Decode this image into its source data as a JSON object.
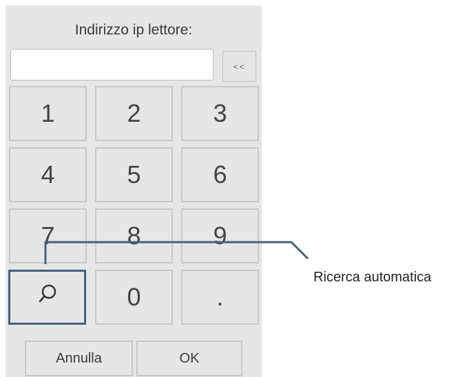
{
  "dialog": {
    "title": "Indirizzo ip lettore:",
    "ip_input": {
      "value": "",
      "placeholder": ""
    },
    "backspace_label": "<<",
    "keys": [
      "1",
      "2",
      "3",
      "4",
      "5",
      "6",
      "7",
      "8",
      "9",
      "",
      "0",
      "."
    ],
    "search_key_icon": "search-icon",
    "cancel_label": "Annulla",
    "ok_label": "OK"
  },
  "callout": {
    "label": "Ricerca automatica",
    "color": "#3f6283"
  },
  "colors": {
    "dialog_bg": "#e6e6e6",
    "key_border": "#c8c8c8",
    "accent": "#3f6283"
  }
}
